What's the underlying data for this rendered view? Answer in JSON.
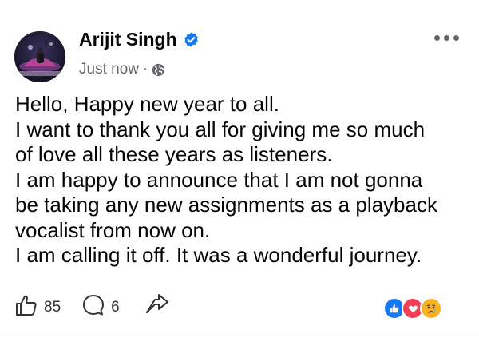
{
  "post": {
    "author": "Arijit Singh",
    "timestamp": "Just now",
    "separator": "·",
    "lines": [
      "Hello, Happy new year to all.",
      "I want to thank you all for giving me so much",
      "of love all these years as listeners.",
      "I am happy to announce that I am not gonna",
      "be taking any new assignments as a playback",
      "vocalist from now on.",
      "I am calling it off. It was a wonderful journey."
    ],
    "like_count": "85",
    "comment_count": "6"
  },
  "icons": {
    "verified": "verified-badge-icon",
    "audience": "globe-icon",
    "more": "more-options-icon",
    "like": "thumbs-up-icon",
    "comment": "comment-icon",
    "share": "share-icon",
    "reactions": [
      "like-reaction-icon",
      "love-reaction-icon",
      "sad-reaction-icon"
    ]
  },
  "colors": {
    "accent": "#1877f2",
    "love": "#f33e58",
    "sad": "#f7b125",
    "secondary_text": "#65676b"
  }
}
